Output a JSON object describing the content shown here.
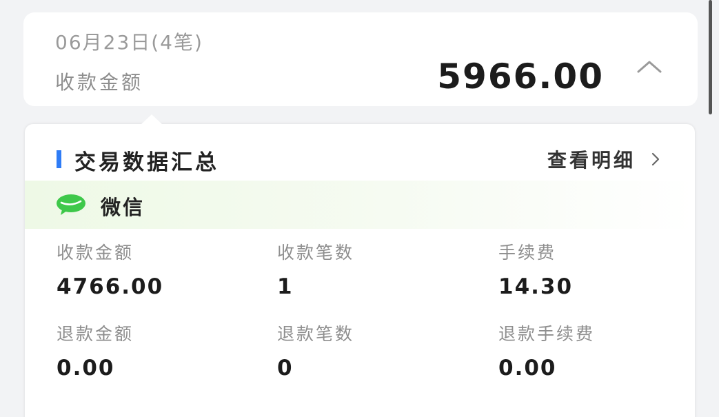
{
  "day_summary": {
    "date_label": "06月23日(4笔)",
    "amount_label": "收款金额",
    "amount_value": "5966.00",
    "collapse_icon": "chevron-up-icon"
  },
  "summary": {
    "title": "交易数据汇总",
    "view_detail_label": "查看明细",
    "view_detail_icon": "chevron-right-icon",
    "accent_color": "#2f7cf6"
  },
  "channel": {
    "name": "微信",
    "icon": "wechat-icon",
    "brand_color": "#3ec84a"
  },
  "stats": {
    "receive_amount_label": "收款金额",
    "receive_amount_value": "4766.00",
    "receive_count_label": "收款笔数",
    "receive_count_value": "1",
    "fee_label": "手续费",
    "fee_value": "14.30",
    "refund_amount_label": "退款金额",
    "refund_amount_value": "0.00",
    "refund_count_label": "退款笔数",
    "refund_count_value": "0",
    "refund_fee_label": "退款手续费",
    "refund_fee_value": "0.00"
  }
}
